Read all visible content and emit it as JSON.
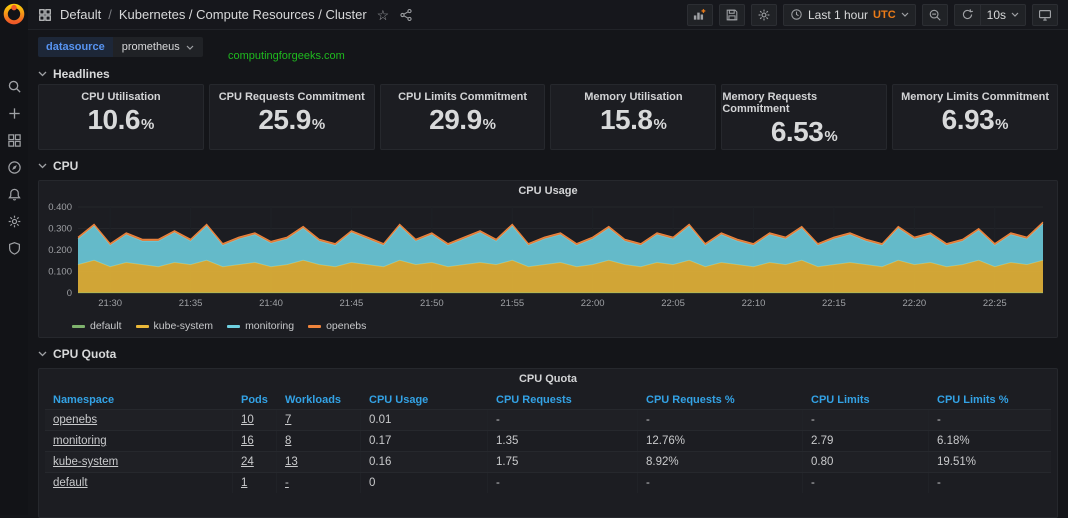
{
  "topnav": {
    "breadcrumb_root": "Default",
    "breadcrumb_sep": "/",
    "breadcrumb_dashboard": "Kubernetes / Compute Resources / Cluster",
    "time_range_label": "Last 1 hour",
    "timezone": "UTC",
    "refresh_interval": "10s"
  },
  "submenu": {
    "datasource_label": "datasource",
    "datasource_value": "prometheus"
  },
  "watermark": "computingforgeeks.com",
  "sections": {
    "headlines": "Headlines",
    "cpu": "CPU",
    "cpu_quota": "CPU Quota"
  },
  "headlines": {
    "panels": [
      {
        "title": "CPU Utilisation",
        "value": "10.6",
        "suffix": "%"
      },
      {
        "title": "CPU Requests Commitment",
        "value": "25.9",
        "suffix": "%"
      },
      {
        "title": "CPU Limits Commitment",
        "value": "29.9",
        "suffix": "%"
      },
      {
        "title": "Memory Utilisation",
        "value": "15.8",
        "suffix": "%"
      },
      {
        "title": "Memory Requests Commitment",
        "value": "6.53",
        "suffix": "%"
      },
      {
        "title": "Memory Limits Commitment",
        "value": "6.93",
        "suffix": "%"
      }
    ]
  },
  "chart_data": {
    "type": "area",
    "title": "CPU Usage",
    "stacked": true,
    "grid": true,
    "legend_position": "bottom-left",
    "ylim": [
      0,
      0.4
    ],
    "y_ticks": {
      "labels": [
        "0",
        "0.100",
        "0.200",
        "0.300",
        "0.400"
      ],
      "values": [
        0,
        0.1,
        0.2,
        0.3,
        0.4
      ]
    },
    "x_tick_labels": [
      "21:30",
      "21:35",
      "21:40",
      "21:45",
      "21:50",
      "21:55",
      "22:00",
      "22:05",
      "22:10",
      "22:15",
      "22:20",
      "22:25"
    ],
    "x_tick_indices": [
      2,
      7,
      12,
      17,
      22,
      27,
      32,
      37,
      42,
      47,
      52,
      57
    ],
    "series": [
      {
        "name": "default",
        "color": "#7EB26D",
        "values": [
          0.002,
          0.002,
          0.002,
          0.002,
          0.002,
          0.002,
          0.002,
          0.002,
          0.002,
          0.002,
          0.002,
          0.002,
          0.002,
          0.002,
          0.002,
          0.002,
          0.002,
          0.002,
          0.002,
          0.002,
          0.002,
          0.002,
          0.002,
          0.002,
          0.002,
          0.002,
          0.002,
          0.002,
          0.002,
          0.002,
          0.002,
          0.002,
          0.002,
          0.002,
          0.002,
          0.002,
          0.002,
          0.002,
          0.002,
          0.002,
          0.002,
          0.002,
          0.002,
          0.002,
          0.002,
          0.002,
          0.002,
          0.002,
          0.002,
          0.002,
          0.002,
          0.002,
          0.002,
          0.002,
          0.002,
          0.002,
          0.002,
          0.002,
          0.002,
          0.002,
          0.002
        ]
      },
      {
        "name": "kube-system",
        "color": "#EAB839",
        "values": [
          0.13,
          0.15,
          0.12,
          0.14,
          0.13,
          0.12,
          0.14,
          0.13,
          0.15,
          0.12,
          0.13,
          0.14,
          0.12,
          0.13,
          0.15,
          0.13,
          0.12,
          0.14,
          0.13,
          0.12,
          0.15,
          0.13,
          0.14,
          0.12,
          0.13,
          0.14,
          0.13,
          0.15,
          0.12,
          0.13,
          0.14,
          0.12,
          0.13,
          0.15,
          0.13,
          0.12,
          0.14,
          0.13,
          0.15,
          0.12,
          0.14,
          0.13,
          0.12,
          0.14,
          0.13,
          0.15,
          0.12,
          0.13,
          0.14,
          0.13,
          0.12,
          0.15,
          0.13,
          0.14,
          0.12,
          0.13,
          0.15,
          0.12,
          0.14,
          0.13,
          0.15
        ]
      },
      {
        "name": "monitoring",
        "color": "#6ED0E0",
        "values": [
          0.12,
          0.16,
          0.1,
          0.13,
          0.11,
          0.12,
          0.14,
          0.11,
          0.16,
          0.1,
          0.12,
          0.13,
          0.11,
          0.12,
          0.15,
          0.11,
          0.1,
          0.14,
          0.12,
          0.1,
          0.16,
          0.11,
          0.13,
          0.1,
          0.12,
          0.14,
          0.11,
          0.16,
          0.1,
          0.12,
          0.13,
          0.1,
          0.12,
          0.15,
          0.11,
          0.1,
          0.13,
          0.12,
          0.16,
          0.1,
          0.13,
          0.11,
          0.1,
          0.13,
          0.12,
          0.15,
          0.1,
          0.12,
          0.13,
          0.11,
          0.1,
          0.15,
          0.12,
          0.13,
          0.1,
          0.11,
          0.14,
          0.1,
          0.13,
          0.12,
          0.17
        ]
      },
      {
        "name": "openebs",
        "color": "#EF843C",
        "values": [
          0.008,
          0.008,
          0.008,
          0.008,
          0.008,
          0.008,
          0.008,
          0.008,
          0.008,
          0.008,
          0.008,
          0.008,
          0.008,
          0.008,
          0.008,
          0.008,
          0.008,
          0.008,
          0.008,
          0.008,
          0.008,
          0.008,
          0.008,
          0.008,
          0.008,
          0.008,
          0.008,
          0.008,
          0.008,
          0.008,
          0.008,
          0.008,
          0.008,
          0.008,
          0.008,
          0.008,
          0.008,
          0.008,
          0.008,
          0.008,
          0.008,
          0.008,
          0.008,
          0.008,
          0.008,
          0.008,
          0.008,
          0.008,
          0.008,
          0.008,
          0.008,
          0.008,
          0.008,
          0.008,
          0.008,
          0.008,
          0.008,
          0.008,
          0.008,
          0.008,
          0.008
        ]
      }
    ]
  },
  "quota_table": {
    "title": "CPU Quota",
    "columns": [
      "Namespace",
      "Pods",
      "Workloads",
      "CPU Usage",
      "CPU Requests",
      "CPU Requests %",
      "CPU Limits",
      "CPU Limits %"
    ],
    "rows": [
      {
        "cells": [
          "openebs",
          "10",
          "7",
          "0.01",
          "-",
          "-",
          "-",
          "-"
        ]
      },
      {
        "cells": [
          "monitoring",
          "16",
          "8",
          "0.17",
          "1.35",
          "12.76%",
          "2.79",
          "6.18%"
        ]
      },
      {
        "cells": [
          "kube-system",
          "24",
          "13",
          "0.16",
          "1.75",
          "8.92%",
          "0.80",
          "19.51%"
        ]
      },
      {
        "cells": [
          "default",
          "1",
          "-",
          "0",
          "-",
          "-",
          "-",
          "-"
        ]
      }
    ]
  }
}
